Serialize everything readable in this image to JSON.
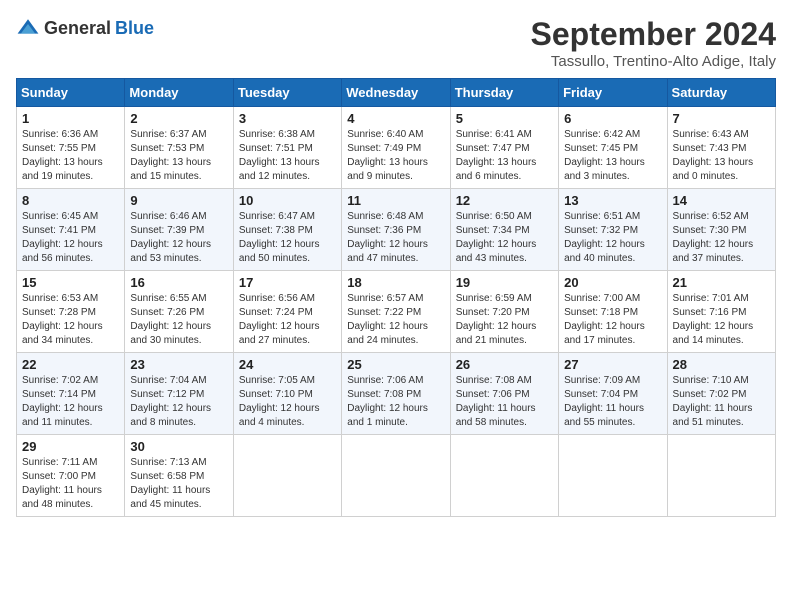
{
  "logo": {
    "text_general": "General",
    "text_blue": "Blue"
  },
  "title": {
    "month_year": "September 2024",
    "location": "Tassullo, Trentino-Alto Adige, Italy"
  },
  "days_of_week": [
    "Sunday",
    "Monday",
    "Tuesday",
    "Wednesday",
    "Thursday",
    "Friday",
    "Saturday"
  ],
  "weeks": [
    [
      {
        "day": "1",
        "sunrise": "6:36 AM",
        "sunset": "7:55 PM",
        "daylight": "13 hours and 19 minutes."
      },
      {
        "day": "2",
        "sunrise": "6:37 AM",
        "sunset": "7:53 PM",
        "daylight": "13 hours and 15 minutes."
      },
      {
        "day": "3",
        "sunrise": "6:38 AM",
        "sunset": "7:51 PM",
        "daylight": "13 hours and 12 minutes."
      },
      {
        "day": "4",
        "sunrise": "6:40 AM",
        "sunset": "7:49 PM",
        "daylight": "13 hours and 9 minutes."
      },
      {
        "day": "5",
        "sunrise": "6:41 AM",
        "sunset": "7:47 PM",
        "daylight": "13 hours and 6 minutes."
      },
      {
        "day": "6",
        "sunrise": "6:42 AM",
        "sunset": "7:45 PM",
        "daylight": "13 hours and 3 minutes."
      },
      {
        "day": "7",
        "sunrise": "6:43 AM",
        "sunset": "7:43 PM",
        "daylight": "13 hours and 0 minutes."
      }
    ],
    [
      {
        "day": "8",
        "sunrise": "6:45 AM",
        "sunset": "7:41 PM",
        "daylight": "12 hours and 56 minutes."
      },
      {
        "day": "9",
        "sunrise": "6:46 AM",
        "sunset": "7:39 PM",
        "daylight": "12 hours and 53 minutes."
      },
      {
        "day": "10",
        "sunrise": "6:47 AM",
        "sunset": "7:38 PM",
        "daylight": "12 hours and 50 minutes."
      },
      {
        "day": "11",
        "sunrise": "6:48 AM",
        "sunset": "7:36 PM",
        "daylight": "12 hours and 47 minutes."
      },
      {
        "day": "12",
        "sunrise": "6:50 AM",
        "sunset": "7:34 PM",
        "daylight": "12 hours and 43 minutes."
      },
      {
        "day": "13",
        "sunrise": "6:51 AM",
        "sunset": "7:32 PM",
        "daylight": "12 hours and 40 minutes."
      },
      {
        "day": "14",
        "sunrise": "6:52 AM",
        "sunset": "7:30 PM",
        "daylight": "12 hours and 37 minutes."
      }
    ],
    [
      {
        "day": "15",
        "sunrise": "6:53 AM",
        "sunset": "7:28 PM",
        "daylight": "12 hours and 34 minutes."
      },
      {
        "day": "16",
        "sunrise": "6:55 AM",
        "sunset": "7:26 PM",
        "daylight": "12 hours and 30 minutes."
      },
      {
        "day": "17",
        "sunrise": "6:56 AM",
        "sunset": "7:24 PM",
        "daylight": "12 hours and 27 minutes."
      },
      {
        "day": "18",
        "sunrise": "6:57 AM",
        "sunset": "7:22 PM",
        "daylight": "12 hours and 24 minutes."
      },
      {
        "day": "19",
        "sunrise": "6:59 AM",
        "sunset": "7:20 PM",
        "daylight": "12 hours and 21 minutes."
      },
      {
        "day": "20",
        "sunrise": "7:00 AM",
        "sunset": "7:18 PM",
        "daylight": "12 hours and 17 minutes."
      },
      {
        "day": "21",
        "sunrise": "7:01 AM",
        "sunset": "7:16 PM",
        "daylight": "12 hours and 14 minutes."
      }
    ],
    [
      {
        "day": "22",
        "sunrise": "7:02 AM",
        "sunset": "7:14 PM",
        "daylight": "12 hours and 11 minutes."
      },
      {
        "day": "23",
        "sunrise": "7:04 AM",
        "sunset": "7:12 PM",
        "daylight": "12 hours and 8 minutes."
      },
      {
        "day": "24",
        "sunrise": "7:05 AM",
        "sunset": "7:10 PM",
        "daylight": "12 hours and 4 minutes."
      },
      {
        "day": "25",
        "sunrise": "7:06 AM",
        "sunset": "7:08 PM",
        "daylight": "12 hours and 1 minute."
      },
      {
        "day": "26",
        "sunrise": "7:08 AM",
        "sunset": "7:06 PM",
        "daylight": "11 hours and 58 minutes."
      },
      {
        "day": "27",
        "sunrise": "7:09 AM",
        "sunset": "7:04 PM",
        "daylight": "11 hours and 55 minutes."
      },
      {
        "day": "28",
        "sunrise": "7:10 AM",
        "sunset": "7:02 PM",
        "daylight": "11 hours and 51 minutes."
      }
    ],
    [
      {
        "day": "29",
        "sunrise": "7:11 AM",
        "sunset": "7:00 PM",
        "daylight": "11 hours and 48 minutes."
      },
      {
        "day": "30",
        "sunrise": "7:13 AM",
        "sunset": "6:58 PM",
        "daylight": "11 hours and 45 minutes."
      },
      null,
      null,
      null,
      null,
      null
    ]
  ]
}
